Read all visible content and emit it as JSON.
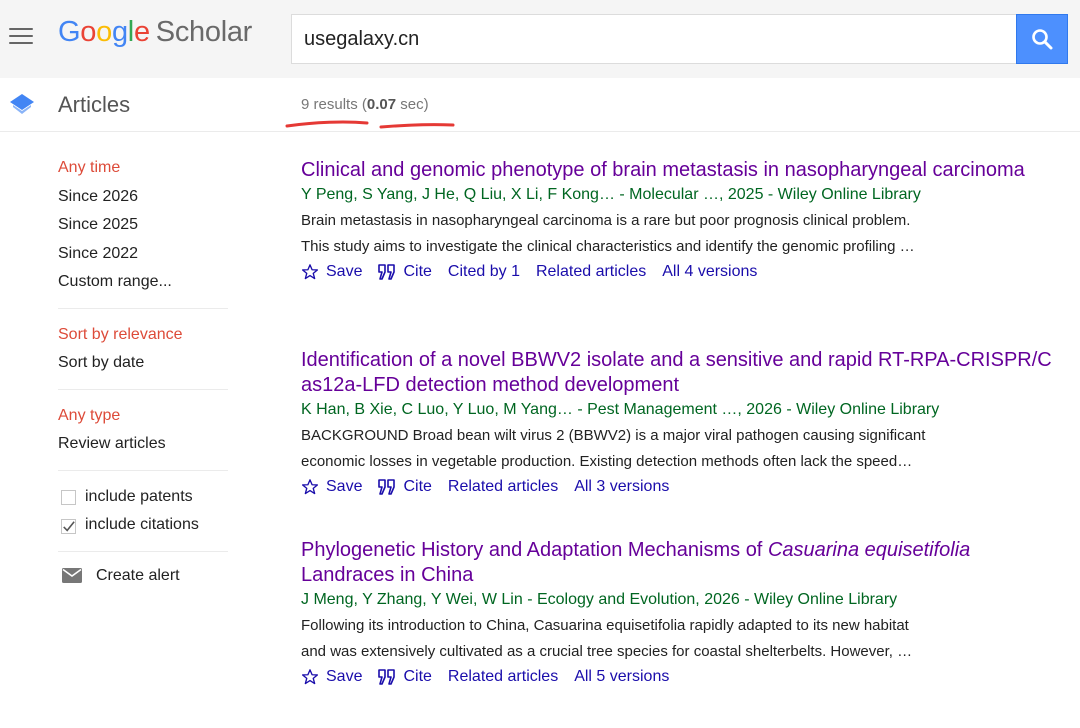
{
  "header": {
    "logo_google": [
      "G",
      "o",
      "o",
      "g",
      "l",
      "e"
    ],
    "logo_scholar": "Scholar",
    "search_query": "usegalaxy.cn"
  },
  "subheader": {
    "section_label": "Articles",
    "results_prefix": "9 results (",
    "results_time": "0.07",
    "results_suffix": " sec)"
  },
  "sidebar": {
    "time_filters": [
      "Any time",
      "Since 2026",
      "Since 2025",
      "Since 2022",
      "Custom range..."
    ],
    "sort_options": [
      "Sort by relevance",
      "Sort by date"
    ],
    "type_filters": [
      "Any type",
      "Review articles"
    ],
    "include_patents": "include patents",
    "include_citations": "include citations",
    "create_alert": "Create alert"
  },
  "results": [
    {
      "title": "Clinical and genomic phenotype of brain metastasis in nasopharyngeal carcinoma",
      "meta": "Y Peng, S Yang, J He, Q Liu, X Li, F Kong… - Molecular …, 2025 - Wiley Online Library",
      "snippet": [
        "Brain metastasis in nasopharyngeal carcinoma is a rare but poor prognosis clinical problem.",
        "This study aims to investigate the clinical characteristics and identify the genomic profiling …"
      ],
      "save": "Save",
      "cite": "Cite",
      "cited_by": "Cited by 1",
      "related": "Related articles",
      "versions": "All 4 versions"
    },
    {
      "title": "Identification of a novel BBWV2 isolate and a sensitive and rapid RT-RPA-CRISPR/C as12a-LFD detection method development",
      "meta": "K Han, B Xie, C Luo, Y Luo, M Yang… - Pest Management …, 2026 - Wiley Online Library",
      "snippet": [
        "BACKGROUND Broad bean wilt virus 2 (BBWV2) is a major viral pathogen causing significant",
        "economic losses in vegetable production. Existing detection methods often lack the speed…"
      ],
      "save": "Save",
      "cite": "Cite",
      "related": "Related articles",
      "versions": "All 3 versions"
    },
    {
      "title_prefix": "Phylogenetic History and Adaptation Mechanisms of ",
      "title_italic": "Casuarina equisetifolia",
      "title_suffix": " Landraces in China",
      "meta": "J Meng, Y Zhang, Y Wei, W Lin - Ecology and Evolution, 2026 - Wiley Online Library",
      "snippet": [
        "Following its introduction to China, Casuarina equisetifolia rapidly adapted to its new habitat",
        "and was extensively cultivated as a crucial tree species for coastal shelterbelts. However, …"
      ],
      "save": "Save",
      "cite": "Cite",
      "related": "Related articles",
      "versions": "All 5 versions"
    }
  ]
}
